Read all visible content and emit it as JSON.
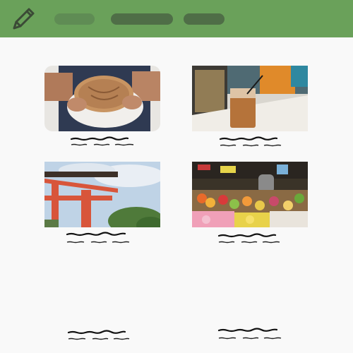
{
  "toolbar": {
    "edit_icon": "pencil-icon",
    "nav_pills": [
      "",
      "",
      ""
    ],
    "bar_color": "#6aa15a"
  },
  "gallery": {
    "items": [
      {
        "image": "bread-loaf-photo",
        "caption": ""
      },
      {
        "image": "iced-coffee-photo",
        "caption": ""
      },
      {
        "image": "torii-gate-photo",
        "caption": ""
      },
      {
        "image": "fruit-market-photo",
        "caption": ""
      },
      {
        "image": "",
        "caption": ""
      },
      {
        "image": "",
        "caption": ""
      }
    ]
  }
}
